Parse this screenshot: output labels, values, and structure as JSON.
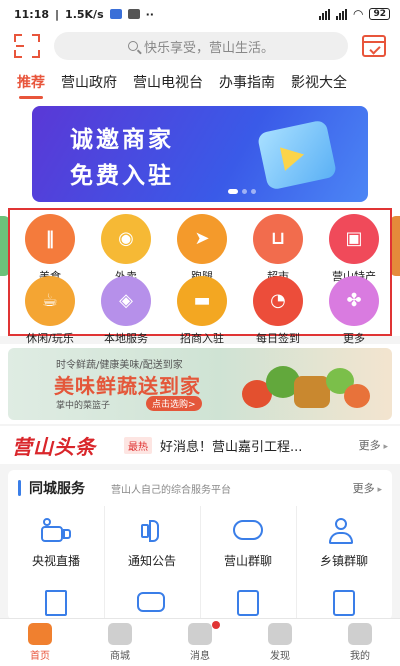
{
  "status": {
    "time": "11:18",
    "speed": "1.5K/s",
    "dots": "··",
    "battery": "92"
  },
  "search": {
    "placeholder": "快乐享受，营山生活。"
  },
  "tabs": [
    "推荐",
    "营山政府",
    "营山电视台",
    "办事指南",
    "影视大全"
  ],
  "banner": {
    "line1": "诚邀商家",
    "line2": "免费入驻"
  },
  "grid": [
    {
      "label": "美食",
      "icon": "utensils-icon",
      "color": "#f47b3c"
    },
    {
      "label": "外卖",
      "icon": "scooter-icon",
      "color": "#f6b935"
    },
    {
      "label": "跑腿",
      "icon": "runner-icon",
      "color": "#f49a2b"
    },
    {
      "label": "超市",
      "icon": "cart-icon",
      "color": "#f26c4d"
    },
    {
      "label": "营山特产",
      "icon": "gift-icon",
      "color": "#f04a5a"
    },
    {
      "label": "休闲/玩乐",
      "icon": "coffee-icon",
      "color": "#f4a533"
    },
    {
      "label": "本地服务",
      "icon": "map-pin-icon",
      "color": "#b690ea"
    },
    {
      "label": "招商入驻",
      "icon": "shop-icon",
      "color": "#f3a722"
    },
    {
      "label": "每日签到",
      "icon": "gauge-icon",
      "color": "#ec4d3a",
      "badge": "每日签到"
    },
    {
      "label": "更多",
      "icon": "clover-icon",
      "color": "#d97be0"
    }
  ],
  "produce": {
    "small": "时令鲜蔬/健康美味/配送到家",
    "big": "美味鲜蔬送到家",
    "sub": "掌中的菜篮子",
    "pill": "点击选购>"
  },
  "headline": {
    "logo": "营山头条",
    "tag": "最热",
    "text": "好消息！营山嘉引工程...",
    "more": "更多"
  },
  "city": {
    "title": "同城服务",
    "subtitle": "营山人自己的综合服务平台",
    "more": "更多",
    "services": [
      {
        "label": "央视直播",
        "icon": "camera-icon"
      },
      {
        "label": "通知公告",
        "icon": "speaker-icon"
      },
      {
        "label": "营山群聊",
        "icon": "chat-icon"
      },
      {
        "label": "乡镇群聊",
        "icon": "group-icon"
      }
    ],
    "row2_icons": [
      "news-icon",
      "message-icon",
      "document-icon",
      "phone-book-icon"
    ]
  },
  "bottomnav": [
    {
      "label": "首页",
      "icon": "home-icon",
      "active": true
    },
    {
      "label": "商城",
      "icon": "bag-icon"
    },
    {
      "label": "消息",
      "icon": "message-icon",
      "badge": true
    },
    {
      "label": "发现",
      "icon": "discover-icon"
    },
    {
      "label": "我的",
      "icon": "profile-icon"
    }
  ]
}
